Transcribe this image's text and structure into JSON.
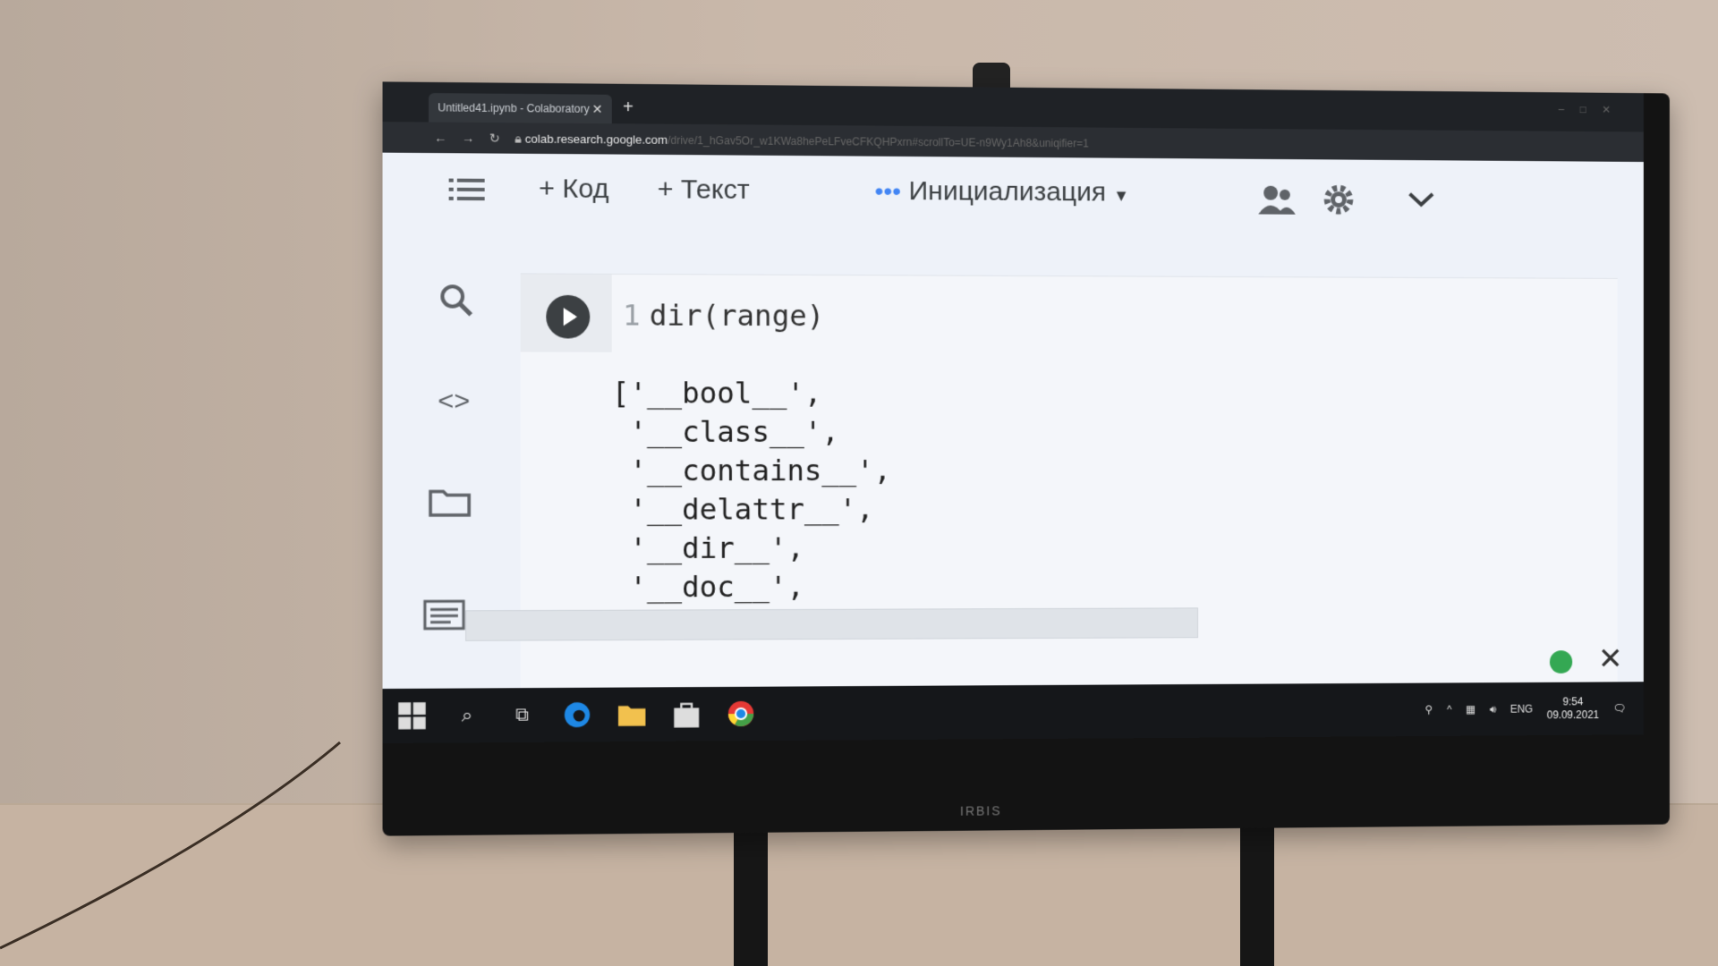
{
  "browser": {
    "tab_title": "Untitled41.ipynb - Colaboratory",
    "url": "colab.research.google.com",
    "url_rest": "/drive/1_hGav5Or_w1KWa8hePeLFveCFKQHPxrn#scrollTo=UE-n9Wy1Ah8&uniqifier=1"
  },
  "toolbar": {
    "add_code": "+ Код",
    "add_text": "+ Текст",
    "status_dots": "•••",
    "status": "Инициализация"
  },
  "cell": {
    "line_number": "1",
    "code": "dir(range)",
    "output": "['__bool__',\n '__class__',\n '__contains__',\n '__delattr__',\n '__dir__',\n '__doc__',"
  },
  "taskbar": {
    "time": "9:54",
    "date": "09.09.2021",
    "lang": "ENG"
  },
  "monitor": {
    "brand": "IRBIS"
  },
  "colors": {
    "status_dot": "#34a853",
    "accent": "#4285f4"
  }
}
